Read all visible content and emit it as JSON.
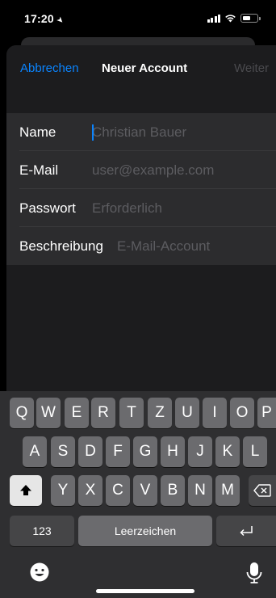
{
  "status": {
    "time": "17:20"
  },
  "nav": {
    "cancel": "Abbrechen",
    "title": "Neuer Account",
    "next": "Weiter"
  },
  "form": {
    "rows": [
      {
        "label": "Name",
        "placeholder": "Christian Bauer"
      },
      {
        "label": "E-Mail",
        "placeholder": "user@example.com"
      },
      {
        "label": "Passwort",
        "placeholder": "Erforderlich"
      },
      {
        "label": "Beschreibung",
        "placeholder": "E-Mail-Account"
      }
    ]
  },
  "keyboard": {
    "row1": [
      "Q",
      "W",
      "E",
      "R",
      "T",
      "Z",
      "U",
      "I",
      "O",
      "P"
    ],
    "row2": [
      "A",
      "S",
      "D",
      "F",
      "G",
      "H",
      "J",
      "K",
      "L"
    ],
    "row3": [
      "Y",
      "X",
      "C",
      "V",
      "B",
      "N",
      "M"
    ],
    "numbers": "123",
    "space": "Leerzeichen",
    "return_icon": "return-icon",
    "shift_icon": "shift-icon",
    "delete_icon": "delete-icon",
    "emoji_icon": "emoji-icon",
    "mic_icon": "microphone-icon"
  },
  "colors": {
    "accent": "#0a84ff",
    "background": "#1c1c1e",
    "key": "#6b6b6e"
  }
}
